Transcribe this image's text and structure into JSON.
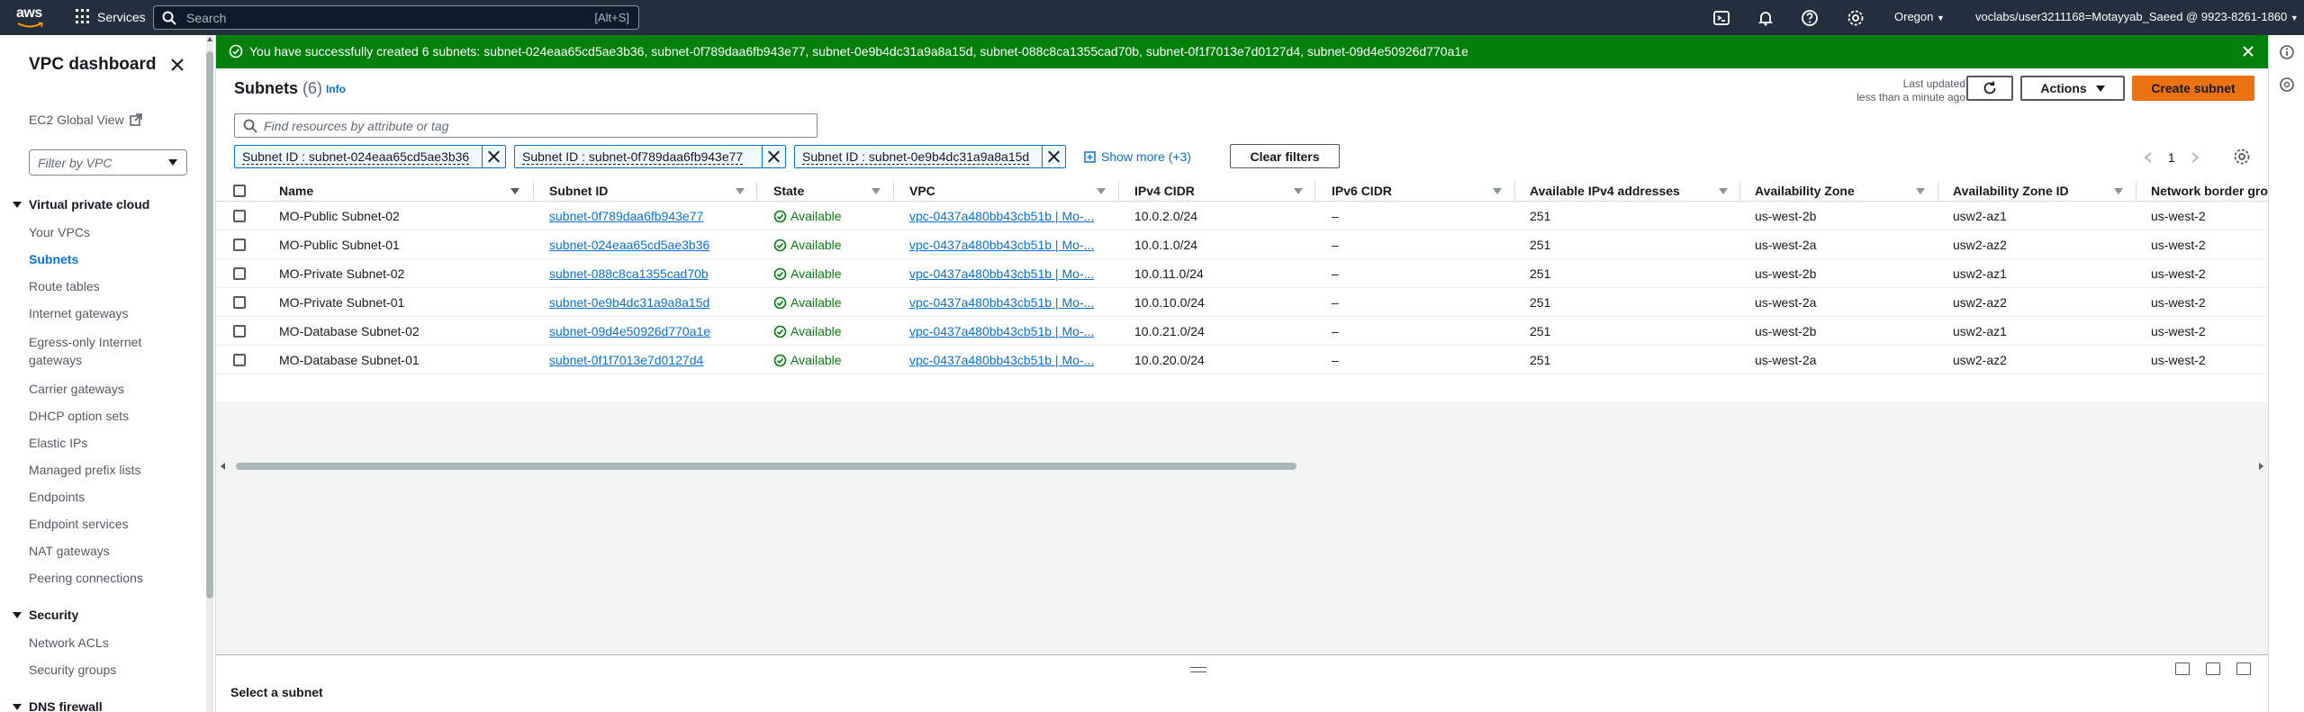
{
  "topnav": {
    "logo_text": "aws",
    "services_label": "Services",
    "search_placeholder": "Search",
    "search_shortcut": "[Alt+S]",
    "region": "Oregon",
    "account": "voclabs/user3211168=Motayyab_Saeed @ 9923-8261-1860"
  },
  "sidenav": {
    "title": "VPC dashboard",
    "ec2_global_view": "EC2 Global View",
    "filter_placeholder": "Filter by VPC",
    "sections": [
      {
        "title": "Virtual private cloud",
        "items": [
          "Your VPCs",
          "Subnets",
          "Route tables",
          "Internet gateways",
          "Egress-only Internet gateways",
          "Carrier gateways",
          "DHCP option sets",
          "Elastic IPs",
          "Managed prefix lists",
          "Endpoints",
          "Endpoint services",
          "NAT gateways",
          "Peering connections"
        ]
      },
      {
        "title": "Security",
        "items": [
          "Network ACLs",
          "Security groups"
        ]
      },
      {
        "title": "DNS firewall",
        "items": []
      }
    ],
    "active_item": "Subnets"
  },
  "banner": {
    "message": "You have successfully created 6 subnets: subnet-024eaa65cd5ae3b36, subnet-0f789daa6fb943e77, subnet-0e9b4dc31a9a8a15d, subnet-088c8ca1355cad70b, subnet-0f1f7013e7d0127d4, subnet-09d4e50926d770a1e",
    "color": "#037f0c"
  },
  "main": {
    "title": "Subnets",
    "count": "(6)",
    "info": "Info",
    "last_updated_label": "Last updated",
    "last_updated_value": "less than a minute ago",
    "actions_label": "Actions",
    "create_label": "Create subnet",
    "find_placeholder": "Find resources by attribute or tag",
    "filters": [
      "Subnet ID : subnet-024eaa65cd5ae3b36",
      "Subnet ID : subnet-0f789daa6fb943e77",
      "Subnet ID : subnet-0e9b4dc31a9a8a15d"
    ],
    "show_more": "Show more (+3)",
    "clear_filters": "Clear filters",
    "page": "1",
    "columns": [
      "Name",
      "Subnet ID",
      "State",
      "VPC",
      "IPv4 CIDR",
      "IPv6 CIDR",
      "Available IPv4 addresses",
      "Availability Zone",
      "Availability Zone ID",
      "Network border gro"
    ],
    "rows": [
      {
        "name": "MO-Public Subnet-02",
        "subnet_id": "subnet-0f789daa6fb943e77",
        "state": "Available",
        "vpc": "vpc-0437a480bb43cb51b | Mo-...",
        "ipv4": "10.0.2.0/24",
        "ipv6": "–",
        "avail": "251",
        "az": "us-west-2b",
        "az_id": "usw2-az1",
        "nbg": "us-west-2"
      },
      {
        "name": "MO-Public Subnet-01",
        "subnet_id": "subnet-024eaa65cd5ae3b36",
        "state": "Available",
        "vpc": "vpc-0437a480bb43cb51b | Mo-...",
        "ipv4": "10.0.1.0/24",
        "ipv6": "–",
        "avail": "251",
        "az": "us-west-2a",
        "az_id": "usw2-az2",
        "nbg": "us-west-2"
      },
      {
        "name": "MO-Private Subnet-02",
        "subnet_id": "subnet-088c8ca1355cad70b",
        "state": "Available",
        "vpc": "vpc-0437a480bb43cb51b | Mo-...",
        "ipv4": "10.0.11.0/24",
        "ipv6": "–",
        "avail": "251",
        "az": "us-west-2b",
        "az_id": "usw2-az1",
        "nbg": "us-west-2"
      },
      {
        "name": "MO-Private Subnet-01",
        "subnet_id": "subnet-0e9b4dc31a9a8a15d",
        "state": "Available",
        "vpc": "vpc-0437a480bb43cb51b | Mo-...",
        "ipv4": "10.0.10.0/24",
        "ipv6": "–",
        "avail": "251",
        "az": "us-west-2a",
        "az_id": "usw2-az2",
        "nbg": "us-west-2"
      },
      {
        "name": "MO-Database Subnet-02",
        "subnet_id": "subnet-09d4e50926d770a1e",
        "state": "Available",
        "vpc": "vpc-0437a480bb43cb51b | Mo-...",
        "ipv4": "10.0.21.0/24",
        "ipv6": "–",
        "avail": "251",
        "az": "us-west-2b",
        "az_id": "usw2-az1",
        "nbg": "us-west-2"
      },
      {
        "name": "MO-Database Subnet-01",
        "subnet_id": "subnet-0f1f7013e7d0127d4",
        "state": "Available",
        "vpc": "vpc-0437a480bb43cb51b | Mo-...",
        "ipv4": "10.0.20.0/24",
        "ipv6": "–",
        "avail": "251",
        "az": "us-west-2a",
        "az_id": "usw2-az2",
        "nbg": "us-west-2"
      }
    ]
  },
  "split_panel": {
    "title": "Select a subnet"
  },
  "colors": {
    "nav_bg": "#232f3e",
    "link": "#0972d3",
    "success": "#037f0c",
    "primary_button": "#ec7211"
  }
}
